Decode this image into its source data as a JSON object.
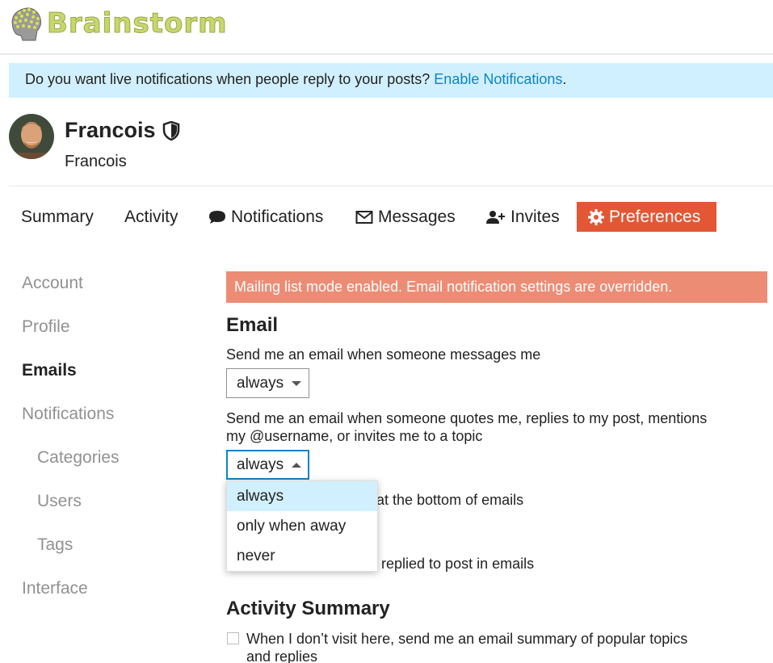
{
  "header": {
    "logo_text": "Brainstorm"
  },
  "banner": {
    "text": "Do you want live notifications when people reply to your posts? ",
    "link": "Enable Notifications",
    "suffix": "."
  },
  "user": {
    "name": "Francois",
    "username": "Francois"
  },
  "nav": {
    "summary": "Summary",
    "activity": "Activity",
    "notifications": "Notifications",
    "messages": "Messages",
    "invites": "Invites",
    "preferences": "Preferences"
  },
  "sidebar": {
    "account": "Account",
    "profile": "Profile",
    "emails": "Emails",
    "notifications": "Notifications",
    "categories": "Categories",
    "users": "Users",
    "tags": "Tags",
    "interface": "Interface"
  },
  "content": {
    "alert": "Mailing list mode enabled. Email notification settings are overridden.",
    "email_heading": "Email",
    "messages_label": "Send me an email when someone messages me",
    "messages_value": "always",
    "quotes_label_1": "Send me an email when someone quotes me, replies to my post, mentions",
    "quotes_label_2": "my @username, or invites me to a topic",
    "quotes_value": "always",
    "hidden_line_1": "s at the bottom of emails",
    "hidden_line_2": "of replied to post in emails",
    "dropdown_options": [
      "always",
      "only when away",
      "never"
    ],
    "activity_heading": "Activity Summary",
    "digest_label_1": "When I don’t visit here, send me an email summary of popular topics",
    "digest_label_2": "and replies"
  },
  "colors": {
    "accent": "#e45735",
    "banner": "#d1f0ff",
    "link": "#0a85c4",
    "alert": "#ed8c75"
  }
}
